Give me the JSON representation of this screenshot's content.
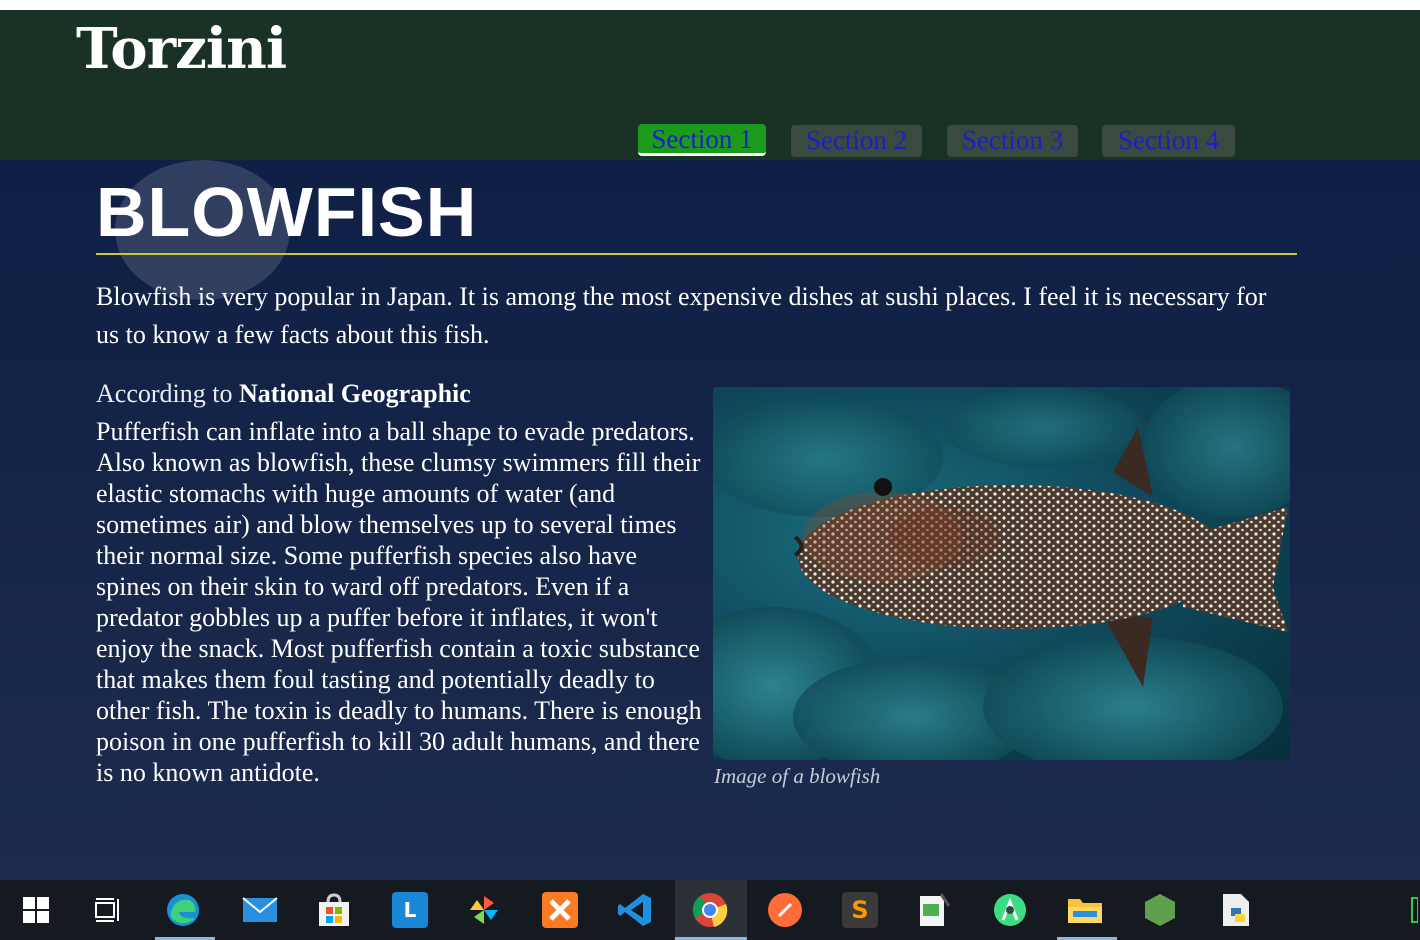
{
  "header": {
    "logo": "Torzini",
    "nav": [
      {
        "label": "Section 1",
        "active": true
      },
      {
        "label": "Section 2",
        "active": false
      },
      {
        "label": "Section 3",
        "active": false
      },
      {
        "label": "Section 4",
        "active": false
      }
    ]
  },
  "article": {
    "title": "BLOWFISH",
    "intro": "Blowfish is very popular in Japan. It is among the most expensive dishes at sushi places. I feel it is necessary for us to know a few facts about this fish.",
    "source_lead": "According to ",
    "source_name": "National Geographic",
    "body": "Pufferfish can inflate into a ball shape to evade predators. Also known as blowfish, these clumsy swimmers fill their elastic stomachs with huge amounts of water (and sometimes air) and blow themselves up to several times their normal size. Some pufferfish species also have spines on their skin to ward off predators. Even if a predator gobbles up a puffer before it inflates, it won't enjoy the snack. Most pufferfish contain a toxic substance that makes them foul tasting and potentially deadly to other fish. The toxin is deadly to humans. There is enough poison in one pufferfish to kill 30 adult humans, and there is no known antidote.",
    "image_caption": "Image of a blowfish"
  },
  "colors": {
    "header_bg": "#1a3126",
    "active_tab": "#1c9a1c",
    "rule": "#c8c837",
    "tab_text": "#1e1ec8"
  },
  "taskbar": {
    "icons": [
      "windows-start-icon",
      "task-view-icon",
      "edge-icon",
      "mail-icon",
      "store-icon",
      "l-app-icon",
      "photos-icon",
      "xampp-icon",
      "vscode-icon",
      "chrome-icon",
      "postman-icon",
      "sublime-text-icon",
      "notepad-icon",
      "android-studio-icon",
      "file-explorer-icon",
      "nodejs-icon",
      "python-file-icon"
    ],
    "l_app_letter": "L",
    "sublime_letter": "S"
  }
}
